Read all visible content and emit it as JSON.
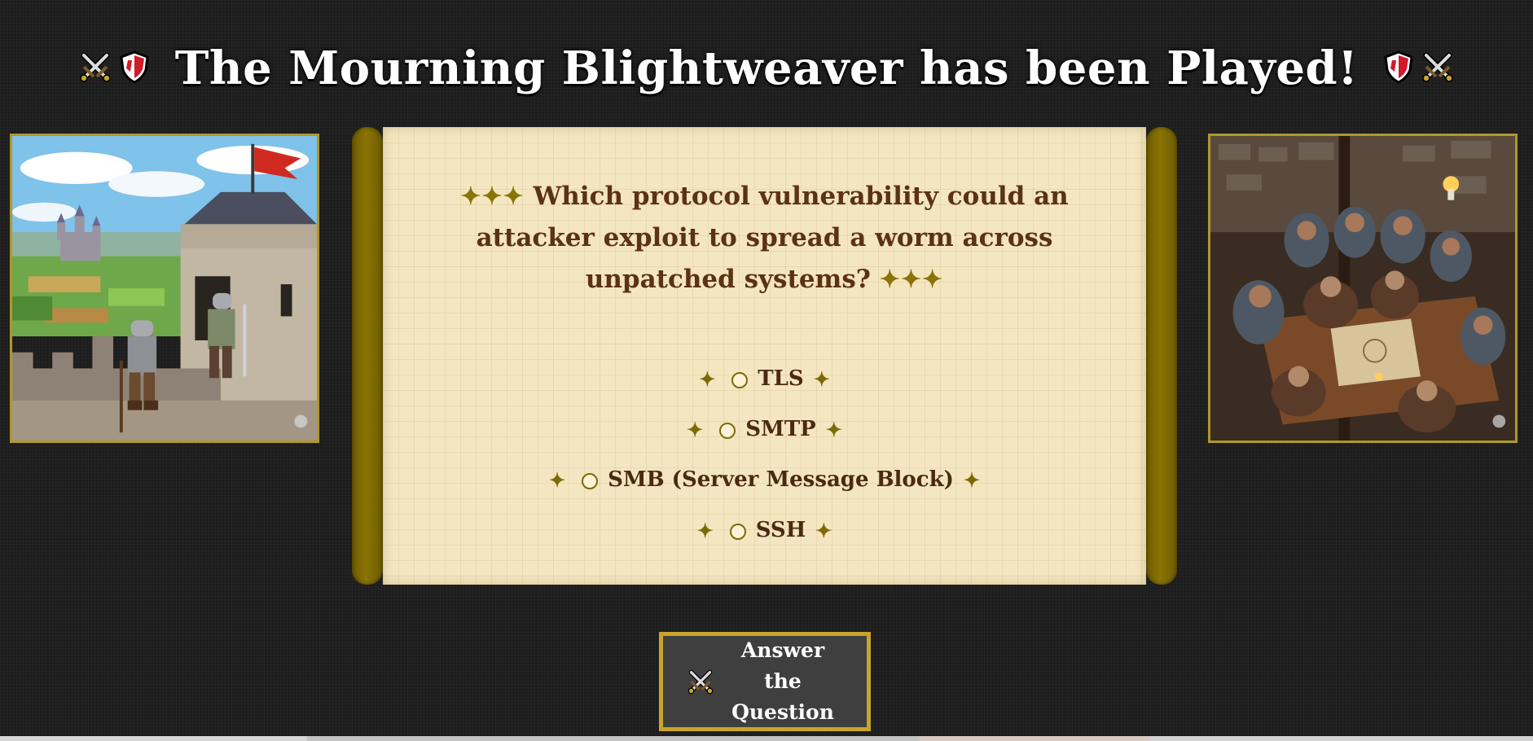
{
  "title": {
    "text": "The Mourning Blightweaver has been Played!",
    "left_icons": [
      "crossed-swords-icon",
      "shield-icon"
    ],
    "right_icons": [
      "shield-icon",
      "crossed-swords-icon"
    ]
  },
  "question": {
    "stars": "✦✦✦",
    "text": "Which protocol vulnerability could an attacker exploit to spread a worm across unpatched systems?",
    "options": [
      {
        "label": "TLS"
      },
      {
        "label": "SMTP"
      },
      {
        "label": "SMB (Server Message Block)"
      },
      {
        "label": "SSH"
      }
    ],
    "option_spark": "✦"
  },
  "answer_button": {
    "icon": "crossed-swords-icon",
    "label": "Answer the Question"
  },
  "images": {
    "left": {
      "name": "castle-tower-knights-image"
    },
    "right": {
      "name": "tavern-war-council-image"
    }
  },
  "colors": {
    "background": "#1d1d1d",
    "parchment": "#f4e6c0",
    "scroll_rod": "#7d6a07",
    "question_text": "#5b3213",
    "accent_gold": "#c9a42a",
    "button_bg": "#3f3f3f"
  }
}
